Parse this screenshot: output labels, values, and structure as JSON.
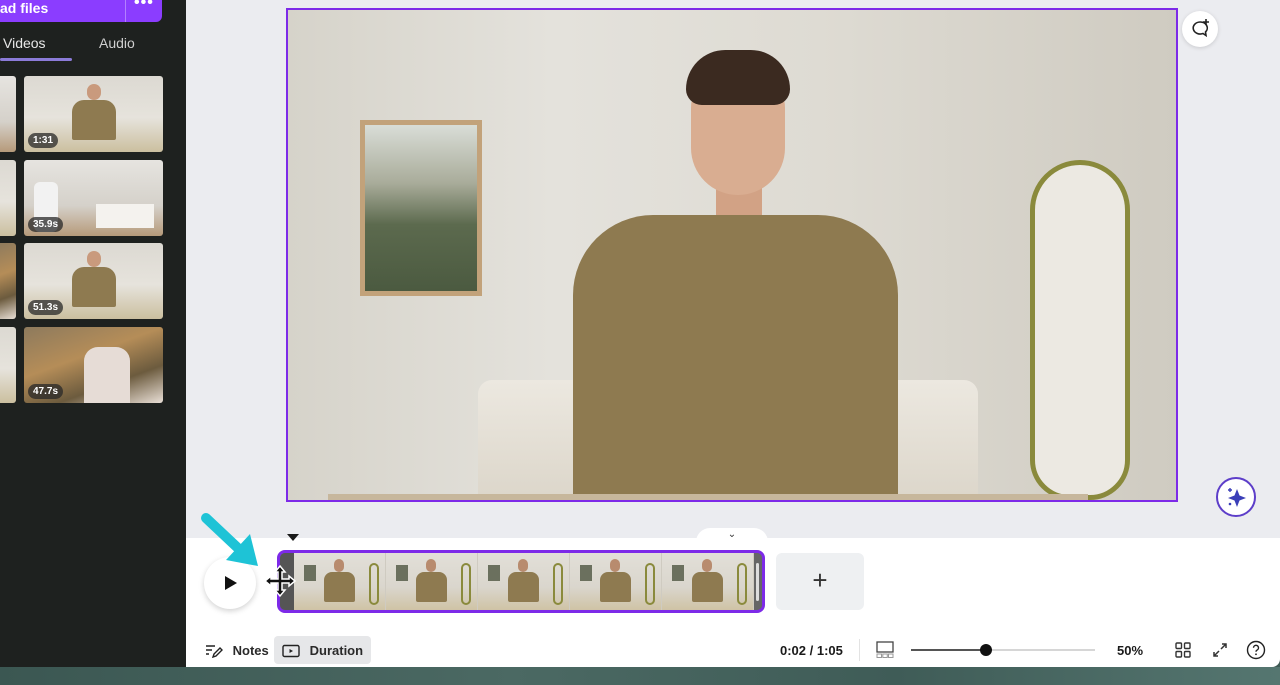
{
  "side_panel": {
    "upload_label": "ad files",
    "more_label": "•••",
    "tabs": [
      {
        "label": "Videos",
        "active": true
      },
      {
        "label": "Audio",
        "active": false
      }
    ],
    "videos": [
      {
        "duration": "1:31",
        "scene": "person"
      },
      {
        "duration": "35.9s",
        "scene": "kitchen"
      },
      {
        "duration": "51.3s",
        "scene": "person"
      },
      {
        "duration": "47.7s",
        "scene": "sunset"
      }
    ],
    "collapse_glyph": "‹"
  },
  "editor": {
    "accent_color": "#7d2ae8"
  },
  "timeline": {
    "collapse_glyph": "⌄",
    "add_clip_glyph": "+",
    "clip_frame_count": 5
  },
  "bottom_bar": {
    "notes_label": "Notes",
    "duration_label": "Duration",
    "time_readout": "0:02 / 1:05",
    "zoom_value": 0.41,
    "zoom_percent": "50%"
  }
}
